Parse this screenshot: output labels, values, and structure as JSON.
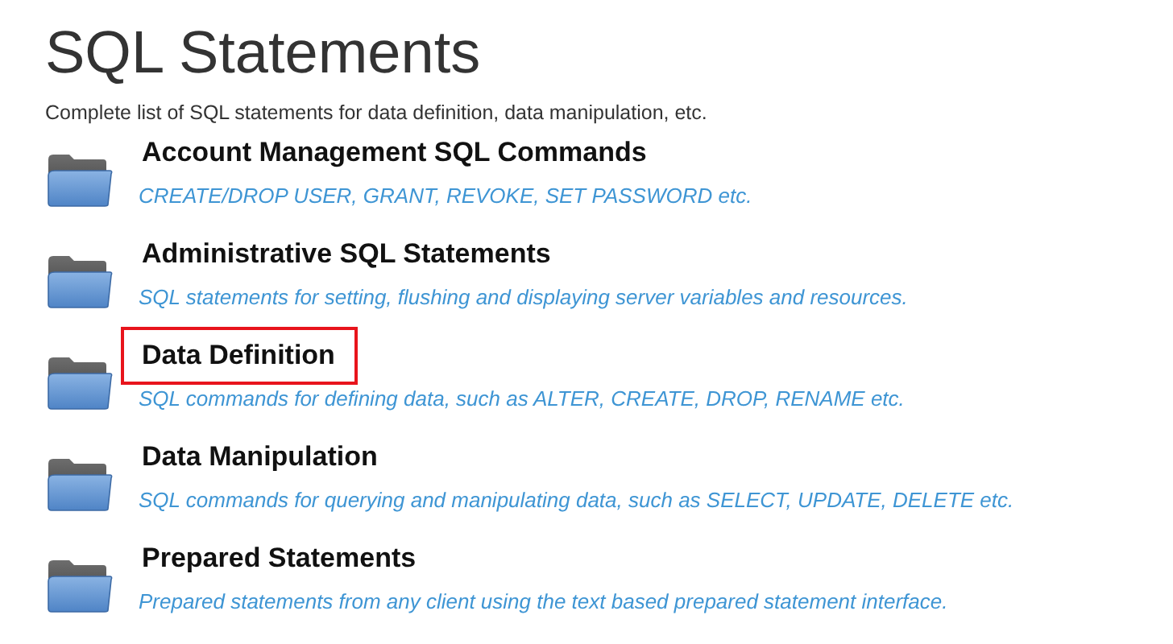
{
  "title": "SQL Statements",
  "intro": "Complete list of SQL statements for data definition, data manipulation, etc.",
  "items": [
    {
      "title": "Account Management SQL Commands",
      "description": "CREATE/DROP USER, GRANT, REVOKE, SET PASSWORD etc.",
      "highlighted": false
    },
    {
      "title": "Administrative SQL Statements",
      "description": "SQL statements for setting, flushing and displaying server variables and resources.",
      "highlighted": false
    },
    {
      "title": "Data Definition",
      "description": "SQL commands for defining data, such as ALTER, CREATE, DROP, RENAME etc.",
      "highlighted": true
    },
    {
      "title": "Data Manipulation",
      "description": "SQL commands for querying and manipulating data, such as SELECT, UPDATE, DELETE etc.",
      "highlighted": false
    },
    {
      "title": "Prepared Statements",
      "description": "Prepared statements from any client using the text based prepared statement interface.",
      "highlighted": false
    }
  ]
}
